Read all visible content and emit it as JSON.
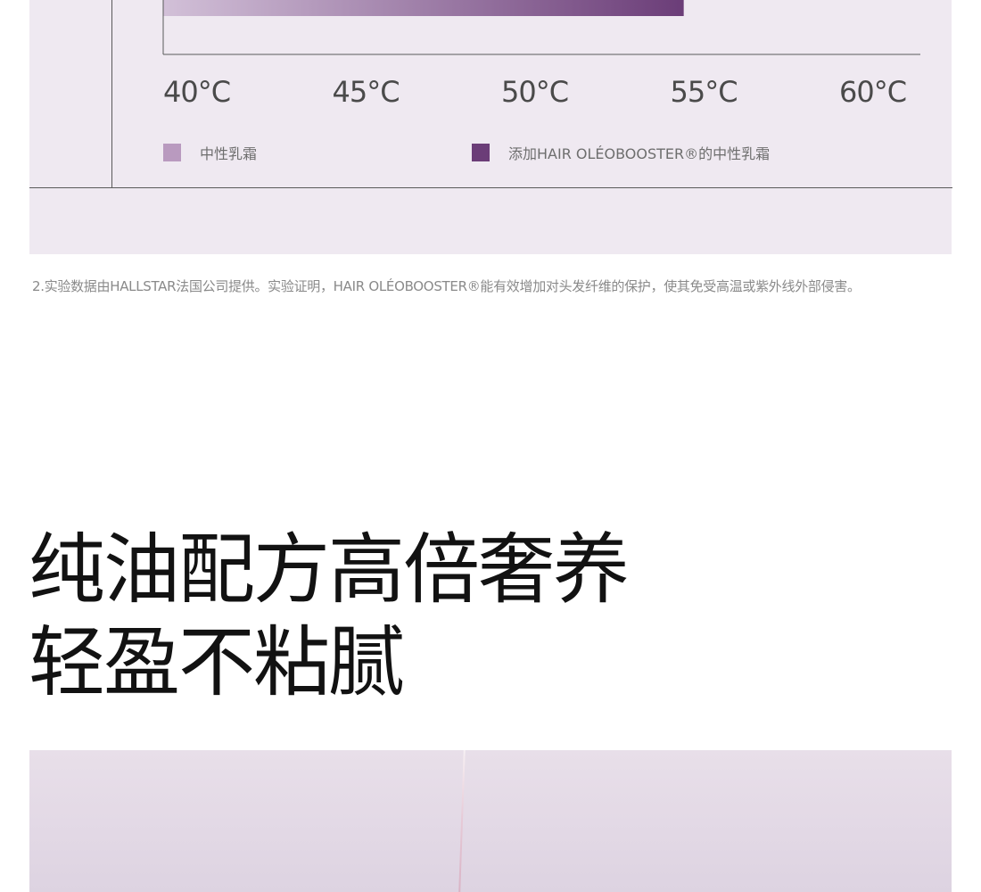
{
  "chart_data": {
    "type": "bar",
    "orientation": "horizontal",
    "xlabel": "",
    "ylabel": "",
    "x_unit": "°C",
    "xlim": [
      40,
      62
    ],
    "x_ticks": [
      40,
      45,
      50,
      55,
      60
    ],
    "x_tick_labels": [
      "40°C",
      "45°C",
      "50°C",
      "55°C",
      "60°C"
    ],
    "series": [
      {
        "name": "添加HAIR OLÉOBOOSTER®的中性乳霜",
        "values": [
          55.4
        ]
      }
    ],
    "legend": [
      {
        "label": "中性乳霜",
        "color": "#b99abf"
      },
      {
        "label": "添加HAIR OLÉOBOOSTER®的中性乳霜",
        "color": "#6b3d78"
      }
    ],
    "legend_position": "bottom",
    "grid": false,
    "colors": {
      "bar_start": "#d2c0d8",
      "bar_end": "#6b3d78",
      "axis": "#5a5a5a",
      "panel_bg": "#efe9f1"
    }
  },
  "footnote": "2.实验数据由HALLSTAR法国公司提供。实验证明，HAIR OLÉOBOOSTER®能有效增加对头发纤维的保护，使其免受高温或紫外线外部侵害。",
  "headline": {
    "line1": "纯油配方高倍奢养",
    "line2": "轻盈不粘腻"
  }
}
